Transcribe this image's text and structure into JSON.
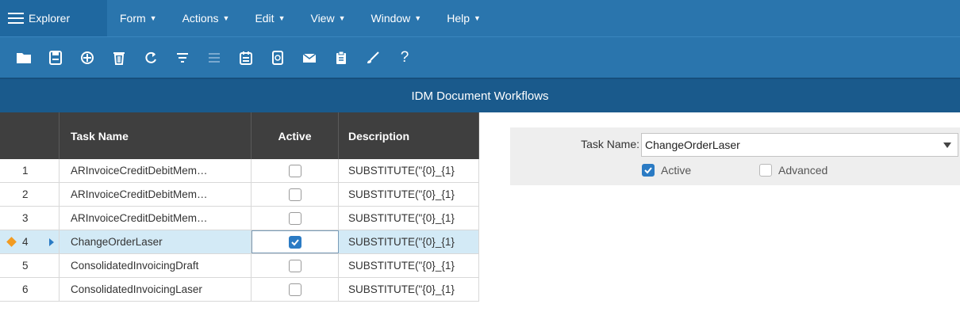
{
  "menu": {
    "explorer": "Explorer",
    "items": [
      {
        "label": "Form"
      },
      {
        "label": "Actions"
      },
      {
        "label": "Edit"
      },
      {
        "label": "View"
      },
      {
        "label": "Window"
      },
      {
        "label": "Help"
      }
    ]
  },
  "toolbar": {
    "icons": [
      "open-folder-icon",
      "save-icon",
      "target-icon",
      "delete-icon",
      "refresh-icon",
      "filter-icon",
      "list-icon",
      "calendar-icon",
      "document-search-icon",
      "email-icon",
      "clipboard-icon",
      "brush-icon",
      "help-icon"
    ],
    "help_label": "?"
  },
  "title": "IDM Document Workflows",
  "grid": {
    "columns": {
      "name": "Task Name",
      "active": "Active",
      "description": "Description"
    },
    "rows": [
      {
        "num": "1",
        "name": "ARInvoiceCreditDebitMem…",
        "active": false,
        "description": "SUBSTITUTE(\"{0}_{1}"
      },
      {
        "num": "2",
        "name": "ARInvoiceCreditDebitMem…",
        "active": false,
        "description": "SUBSTITUTE(\"{0}_{1}"
      },
      {
        "num": "3",
        "name": "ARInvoiceCreditDebitMem…",
        "active": false,
        "description": "SUBSTITUTE(\"{0}_{1}"
      },
      {
        "num": "4",
        "name": "ChangeOrderLaser",
        "active": true,
        "description": "SUBSTITUTE(\"{0}_{1}"
      },
      {
        "num": "5",
        "name": "ConsolidatedInvoicingDraft",
        "active": false,
        "description": "SUBSTITUTE(\"{0}_{1}"
      },
      {
        "num": "6",
        "name": "ConsolidatedInvoicingLaser",
        "active": false,
        "description": "SUBSTITUTE(\"{0}_{1}"
      }
    ]
  },
  "form": {
    "task_label": "Task Name:",
    "task_value": "ChangeOrderLaser",
    "active_label": "Active",
    "advanced_label": "Advanced"
  },
  "colors": {
    "menubar": "#2a75ad",
    "titlebar": "#1a5a8c",
    "header": "#3f3f3f",
    "selected": "#d3eaf6",
    "accent": "#2b7bc4"
  }
}
